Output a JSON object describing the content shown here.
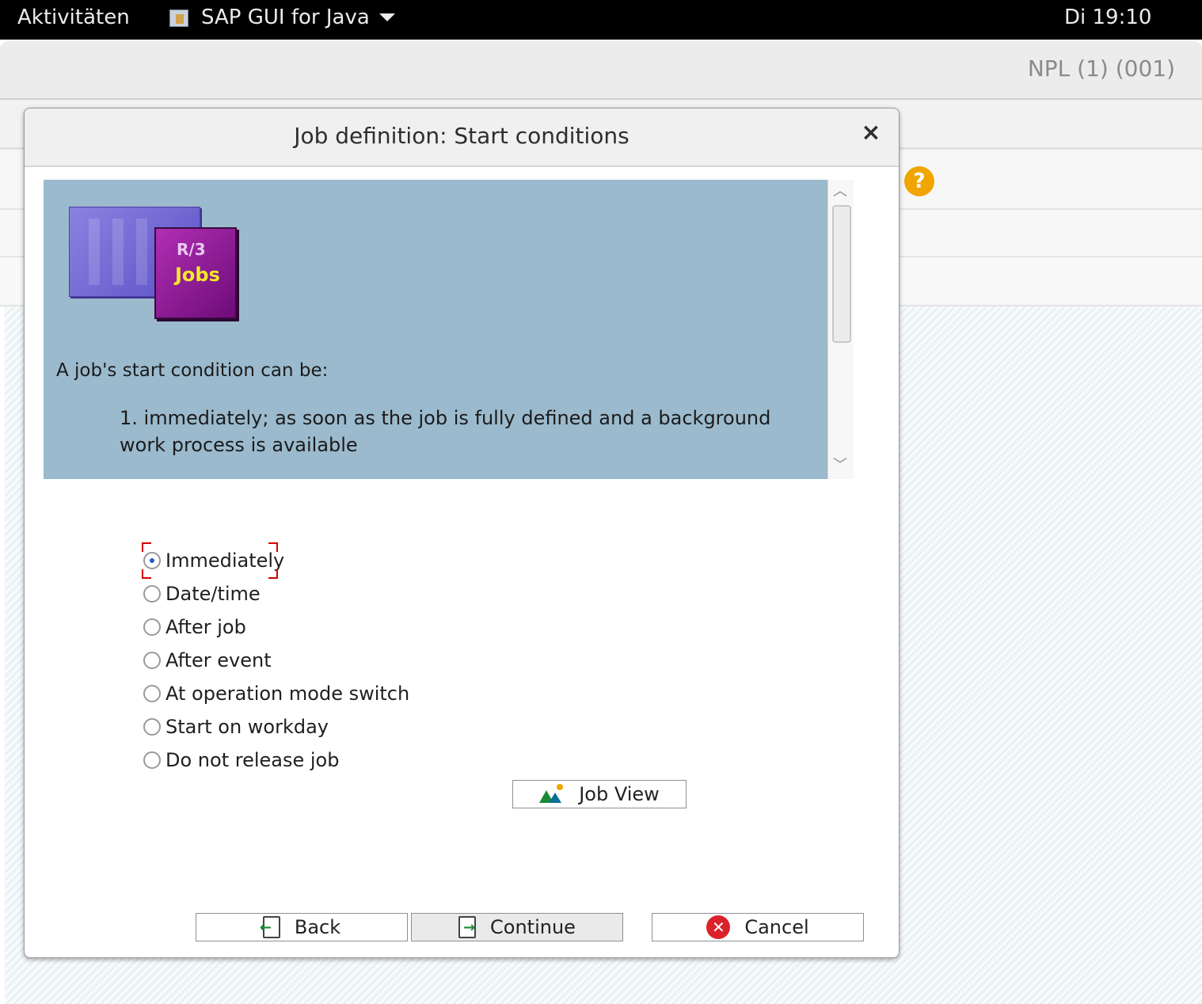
{
  "topbar": {
    "activities": "Aktivitäten",
    "app_name": "SAP GUI for Java",
    "clock": "Di 19:10"
  },
  "background_window": {
    "system_info": "NPL (1) (001)",
    "help_icon": "?"
  },
  "dialog": {
    "title": "Job definition: Start conditions",
    "close_glyph": "×",
    "logo": {
      "r3": "R/3",
      "jobs": "Jobs"
    },
    "info": {
      "intro": "A job's start condition can be:",
      "item1": "1. immediately; as soon as the job is fully defined and a background work process is available"
    },
    "options": [
      {
        "label": "Immediately",
        "checked": true
      },
      {
        "label": "Date/time",
        "checked": false
      },
      {
        "label": "After job",
        "checked": false
      },
      {
        "label": "After event",
        "checked": false
      },
      {
        "label": "At operation mode switch",
        "checked": false
      },
      {
        "label": "Start on workday",
        "checked": false
      },
      {
        "label": "Do not release job",
        "checked": false
      }
    ],
    "job_view_label": "Job View",
    "buttons": {
      "back": "Back",
      "continue": "Continue",
      "cancel": "Cancel"
    }
  },
  "colors": {
    "info_background": "#9bbacd",
    "radio_checked": "#1d5fc4",
    "focus_ring": "#d40000",
    "cancel_red": "#d9222a",
    "help_orange": "#f0a500"
  }
}
